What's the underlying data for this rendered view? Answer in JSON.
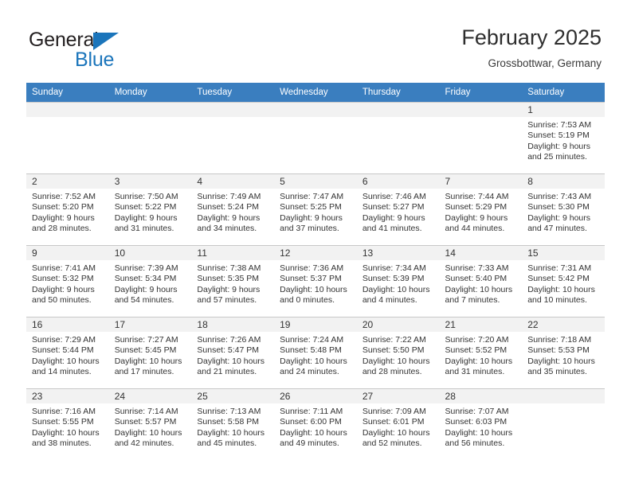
{
  "brand": {
    "name_top": "General",
    "name_bottom": "Blue",
    "triangle_color": "#1b75bb"
  },
  "header": {
    "title": "February 2025",
    "location": "Grossbottwar, Germany"
  },
  "calendar": {
    "header_bg": "#3a7ebf",
    "weekdays": [
      "Sunday",
      "Monday",
      "Tuesday",
      "Wednesday",
      "Thursday",
      "Friday",
      "Saturday"
    ],
    "weeks": [
      [
        {
          "day": "",
          "sunrise": "",
          "sunset": "",
          "daylight": "",
          "empty": true
        },
        {
          "day": "",
          "sunrise": "",
          "sunset": "",
          "daylight": "",
          "empty": true
        },
        {
          "day": "",
          "sunrise": "",
          "sunset": "",
          "daylight": "",
          "empty": true
        },
        {
          "day": "",
          "sunrise": "",
          "sunset": "",
          "daylight": "",
          "empty": true
        },
        {
          "day": "",
          "sunrise": "",
          "sunset": "",
          "daylight": "",
          "empty": true
        },
        {
          "day": "",
          "sunrise": "",
          "sunset": "",
          "daylight": "",
          "empty": true
        },
        {
          "day": "1",
          "sunrise": "Sunrise: 7:53 AM",
          "sunset": "Sunset: 5:19 PM",
          "daylight": "Daylight: 9 hours and 25 minutes.",
          "empty": false
        }
      ],
      [
        {
          "day": "2",
          "sunrise": "Sunrise: 7:52 AM",
          "sunset": "Sunset: 5:20 PM",
          "daylight": "Daylight: 9 hours and 28 minutes.",
          "empty": false
        },
        {
          "day": "3",
          "sunrise": "Sunrise: 7:50 AM",
          "sunset": "Sunset: 5:22 PM",
          "daylight": "Daylight: 9 hours and 31 minutes.",
          "empty": false
        },
        {
          "day": "4",
          "sunrise": "Sunrise: 7:49 AM",
          "sunset": "Sunset: 5:24 PM",
          "daylight": "Daylight: 9 hours and 34 minutes.",
          "empty": false
        },
        {
          "day": "5",
          "sunrise": "Sunrise: 7:47 AM",
          "sunset": "Sunset: 5:25 PM",
          "daylight": "Daylight: 9 hours and 37 minutes.",
          "empty": false
        },
        {
          "day": "6",
          "sunrise": "Sunrise: 7:46 AM",
          "sunset": "Sunset: 5:27 PM",
          "daylight": "Daylight: 9 hours and 41 minutes.",
          "empty": false
        },
        {
          "day": "7",
          "sunrise": "Sunrise: 7:44 AM",
          "sunset": "Sunset: 5:29 PM",
          "daylight": "Daylight: 9 hours and 44 minutes.",
          "empty": false
        },
        {
          "day": "8",
          "sunrise": "Sunrise: 7:43 AM",
          "sunset": "Sunset: 5:30 PM",
          "daylight": "Daylight: 9 hours and 47 minutes.",
          "empty": false
        }
      ],
      [
        {
          "day": "9",
          "sunrise": "Sunrise: 7:41 AM",
          "sunset": "Sunset: 5:32 PM",
          "daylight": "Daylight: 9 hours and 50 minutes.",
          "empty": false
        },
        {
          "day": "10",
          "sunrise": "Sunrise: 7:39 AM",
          "sunset": "Sunset: 5:34 PM",
          "daylight": "Daylight: 9 hours and 54 minutes.",
          "empty": false
        },
        {
          "day": "11",
          "sunrise": "Sunrise: 7:38 AM",
          "sunset": "Sunset: 5:35 PM",
          "daylight": "Daylight: 9 hours and 57 minutes.",
          "empty": false
        },
        {
          "day": "12",
          "sunrise": "Sunrise: 7:36 AM",
          "sunset": "Sunset: 5:37 PM",
          "daylight": "Daylight: 10 hours and 0 minutes.",
          "empty": false
        },
        {
          "day": "13",
          "sunrise": "Sunrise: 7:34 AM",
          "sunset": "Sunset: 5:39 PM",
          "daylight": "Daylight: 10 hours and 4 minutes.",
          "empty": false
        },
        {
          "day": "14",
          "sunrise": "Sunrise: 7:33 AM",
          "sunset": "Sunset: 5:40 PM",
          "daylight": "Daylight: 10 hours and 7 minutes.",
          "empty": false
        },
        {
          "day": "15",
          "sunrise": "Sunrise: 7:31 AM",
          "sunset": "Sunset: 5:42 PM",
          "daylight": "Daylight: 10 hours and 10 minutes.",
          "empty": false
        }
      ],
      [
        {
          "day": "16",
          "sunrise": "Sunrise: 7:29 AM",
          "sunset": "Sunset: 5:44 PM",
          "daylight": "Daylight: 10 hours and 14 minutes.",
          "empty": false
        },
        {
          "day": "17",
          "sunrise": "Sunrise: 7:27 AM",
          "sunset": "Sunset: 5:45 PM",
          "daylight": "Daylight: 10 hours and 17 minutes.",
          "empty": false
        },
        {
          "day": "18",
          "sunrise": "Sunrise: 7:26 AM",
          "sunset": "Sunset: 5:47 PM",
          "daylight": "Daylight: 10 hours and 21 minutes.",
          "empty": false
        },
        {
          "day": "19",
          "sunrise": "Sunrise: 7:24 AM",
          "sunset": "Sunset: 5:48 PM",
          "daylight": "Daylight: 10 hours and 24 minutes.",
          "empty": false
        },
        {
          "day": "20",
          "sunrise": "Sunrise: 7:22 AM",
          "sunset": "Sunset: 5:50 PM",
          "daylight": "Daylight: 10 hours and 28 minutes.",
          "empty": false
        },
        {
          "day": "21",
          "sunrise": "Sunrise: 7:20 AM",
          "sunset": "Sunset: 5:52 PM",
          "daylight": "Daylight: 10 hours and 31 minutes.",
          "empty": false
        },
        {
          "day": "22",
          "sunrise": "Sunrise: 7:18 AM",
          "sunset": "Sunset: 5:53 PM",
          "daylight": "Daylight: 10 hours and 35 minutes.",
          "empty": false
        }
      ],
      [
        {
          "day": "23",
          "sunrise": "Sunrise: 7:16 AM",
          "sunset": "Sunset: 5:55 PM",
          "daylight": "Daylight: 10 hours and 38 minutes.",
          "empty": false
        },
        {
          "day": "24",
          "sunrise": "Sunrise: 7:14 AM",
          "sunset": "Sunset: 5:57 PM",
          "daylight": "Daylight: 10 hours and 42 minutes.",
          "empty": false
        },
        {
          "day": "25",
          "sunrise": "Sunrise: 7:13 AM",
          "sunset": "Sunset: 5:58 PM",
          "daylight": "Daylight: 10 hours and 45 minutes.",
          "empty": false
        },
        {
          "day": "26",
          "sunrise": "Sunrise: 7:11 AM",
          "sunset": "Sunset: 6:00 PM",
          "daylight": "Daylight: 10 hours and 49 minutes.",
          "empty": false
        },
        {
          "day": "27",
          "sunrise": "Sunrise: 7:09 AM",
          "sunset": "Sunset: 6:01 PM",
          "daylight": "Daylight: 10 hours and 52 minutes.",
          "empty": false
        },
        {
          "day": "28",
          "sunrise": "Sunrise: 7:07 AM",
          "sunset": "Sunset: 6:03 PM",
          "daylight": "Daylight: 10 hours and 56 minutes.",
          "empty": false
        },
        {
          "day": "",
          "sunrise": "",
          "sunset": "",
          "daylight": "",
          "empty": true
        }
      ]
    ]
  }
}
